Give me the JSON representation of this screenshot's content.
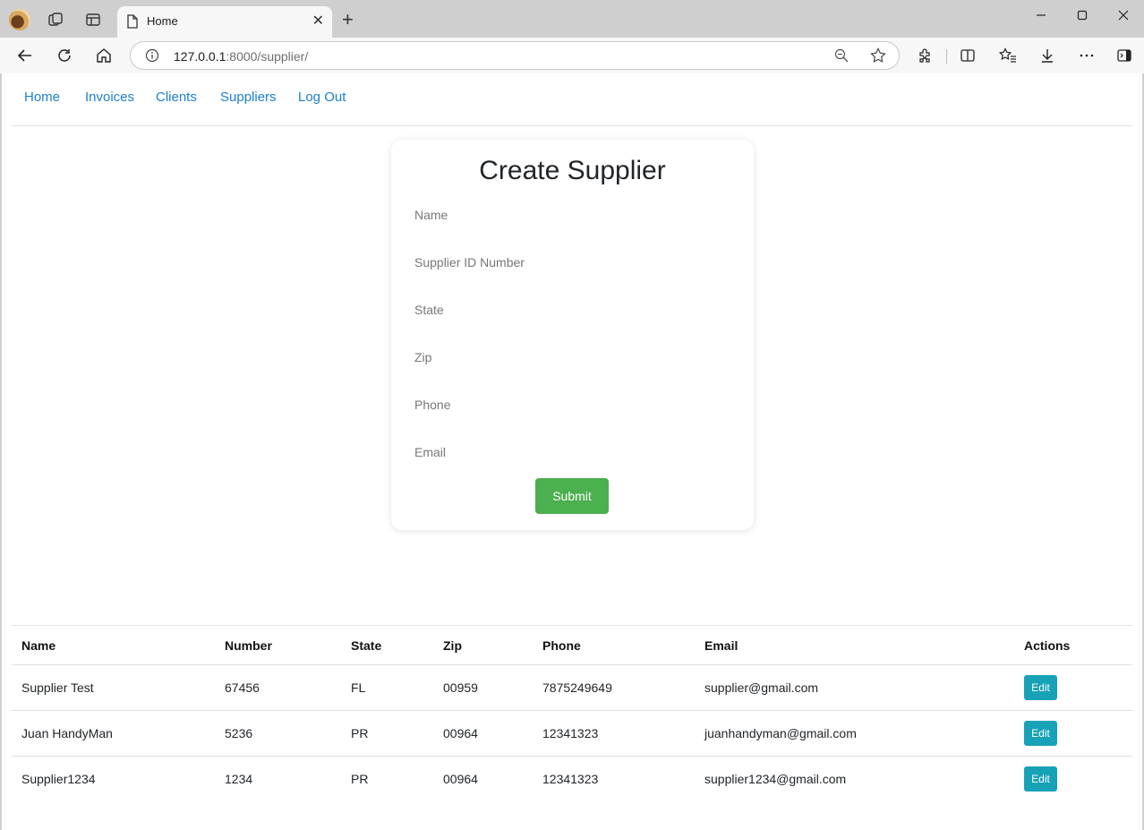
{
  "browser": {
    "tab_title": "Home",
    "url_host": "127.0.0.1",
    "url_rest": ":8000/supplier/"
  },
  "nav": {
    "items": [
      "Home",
      "Invoices",
      "Clients",
      "Suppliers",
      "Log Out"
    ]
  },
  "form": {
    "title": "Create Supplier",
    "fields": {
      "name": "Name",
      "supplier_id": "Supplier ID Number",
      "state": "State",
      "zip": "Zip",
      "phone": "Phone",
      "email": "Email"
    },
    "submit_label": "Submit"
  },
  "table": {
    "headers": [
      "Name",
      "Number",
      "State",
      "Zip",
      "Phone",
      "Email",
      "Actions"
    ],
    "rows": [
      {
        "name": "Supplier Test",
        "number": "67456",
        "state": "FL",
        "zip": "00959",
        "phone": "7875249649",
        "email": "supplier@gmail.com",
        "action": "Edit"
      },
      {
        "name": "Juan HandyMan",
        "number": "5236",
        "state": "PR",
        "zip": "00964",
        "phone": "12341323",
        "email": "juanhandyman@gmail.com",
        "action": "Edit"
      },
      {
        "name": "Supplier1234",
        "number": "1234",
        "state": "PR",
        "zip": "00964",
        "phone": "12341323",
        "email": "supplier1234@gmail.com",
        "action": "Edit"
      }
    ]
  },
  "colors": {
    "link": "#1a7fd4",
    "submit": "#4caf50",
    "edit": "#17a2b8"
  }
}
